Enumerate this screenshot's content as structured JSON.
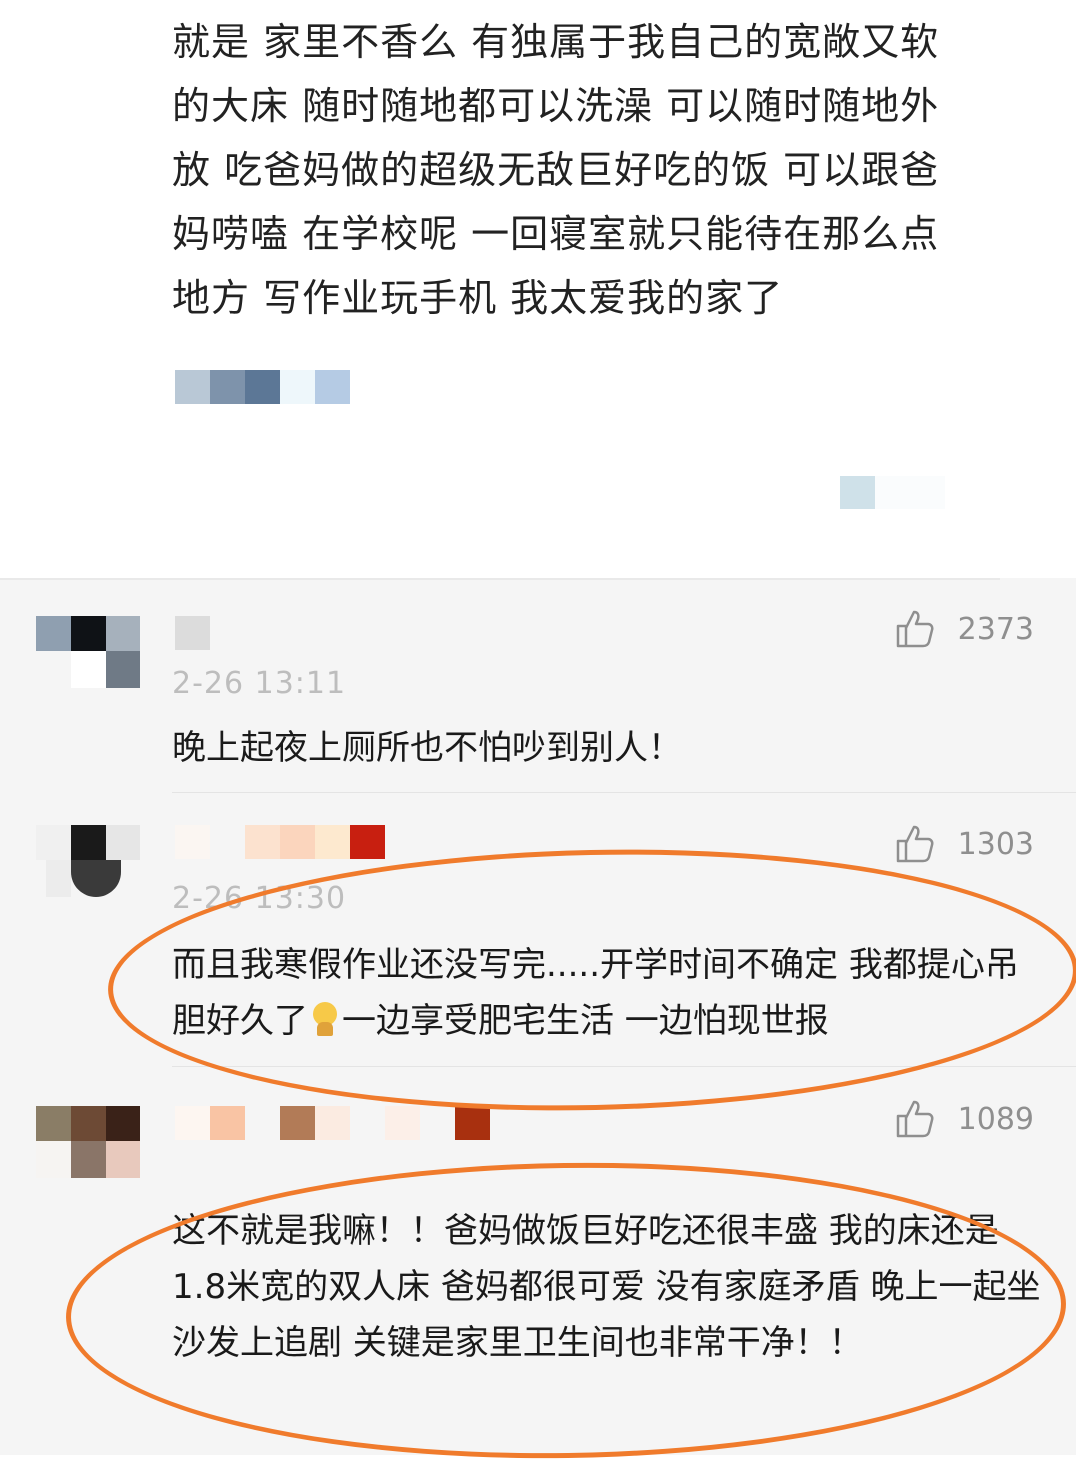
{
  "post": {
    "lines": [
      "就是 家里不香么 有独属于我自己的宽敞又软",
      "的大床 随时随地都可以洗澡 可以随时随地外",
      "放 吃爸妈做的超级无敌巨好吃的饭 可以跟爸",
      "妈唠嗑 在学校呢 一回寝室就只能待在那么点",
      "地方 写作业玩手机 我太爱我的家了"
    ]
  },
  "comments": [
    {
      "likes": "2373",
      "time": "2-26 13:11",
      "text": "晚上起夜上厕所也不怕吵到别人！"
    },
    {
      "likes": "1303",
      "time": "2-26 13:30",
      "text_before_emoji": "而且我寒假作业还没写完.....开学时间不确定 我都提心吊胆好久了",
      "emoji_name": "sweat-smile-emoji-icon",
      "text_after_emoji": "一边享受肥宅生活 一边怕现世报"
    },
    {
      "likes": "1089",
      "text": "这不就是我嘛！！爸妈做饭巨好吃还很丰盛 我的床还是1.8米宽的双人床 爸妈都很可爱 没有家庭矛盾 晚上一起坐沙发上追剧 关键是家里卫生间也非常干净！！"
    }
  ],
  "colors": {
    "highlight": "#f07b2c",
    "comment_bg": "#f5f5f5"
  }
}
